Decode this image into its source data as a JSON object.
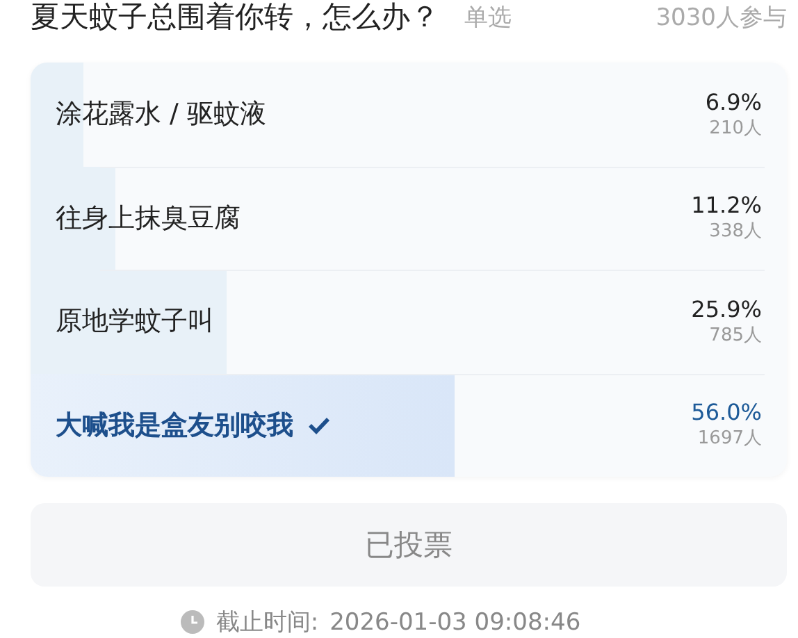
{
  "poll": {
    "question": "夏天蚊子总围着你转，怎么办？",
    "mode": "单选",
    "participants": "3030人参与"
  },
  "options": [
    {
      "label": "涂花露水 / 驱蚊液",
      "percent": "6.9%",
      "count": "210人",
      "level": 0.069,
      "selected": false
    },
    {
      "label": "往身上抹臭豆腐",
      "percent": "11.2%",
      "count": "338人",
      "level": 0.112,
      "selected": false
    },
    {
      "label": "原地学蚊子叫",
      "percent": "25.9%",
      "count": "785人",
      "level": 0.259,
      "selected": false
    },
    {
      "label": "大喊我是盒友别咬我",
      "percent": "56.0%",
      "count": "1697人",
      "level": 0.56,
      "selected": true
    }
  ],
  "vote_button": {
    "label": "已投票",
    "disabled": true
  },
  "deadline": {
    "label": "截止时间:",
    "time": "2026-01-03 09:08:46"
  }
}
